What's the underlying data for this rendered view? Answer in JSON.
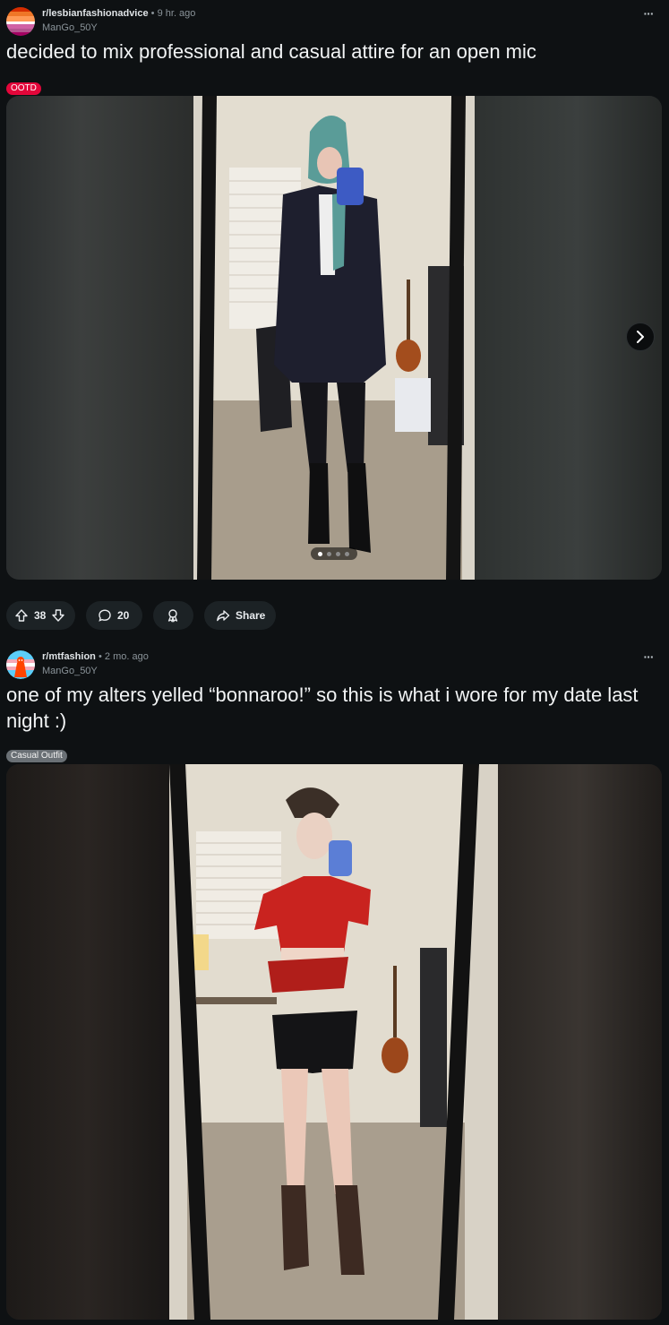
{
  "posts": [
    {
      "subreddit": "r/lesbianfashionadvice",
      "separator": "•",
      "time": "9 hr. ago",
      "author": "ManGo_50Y",
      "more_icon": "ellipsis-icon",
      "title": "decided to mix professional and casual attire for an open mic",
      "flair": "OOTD",
      "flair_color": "#e3063a",
      "media": {
        "description_icon": "photo-mirror-selfie",
        "carousel_count": 4,
        "carousel_active": 1,
        "next_icon": "chevron-right-icon"
      },
      "actions": {
        "votes": "38",
        "upvote_icon": "arrow-up-icon",
        "downvote_icon": "arrow-down-icon",
        "comments": "20",
        "comment_icon": "speech-bubble-icon",
        "award_icon": "award-icon",
        "share_label": "Share",
        "share_icon": "share-arrow-icon"
      }
    },
    {
      "subreddit": "r/mtfashion",
      "separator": "•",
      "time": "2 mo. ago",
      "author": "ManGo_50Y",
      "more_icon": "ellipsis-icon",
      "title": "one of my alters yelled “bonnaroo!” so this is what i wore for my date last night :)",
      "flair": "Casual Outfit",
      "flair_color": "#6a7075"
    }
  ],
  "colors": {
    "background": "#0e1113",
    "pill": "#1c2225",
    "text": "#f2f4f5",
    "muted": "#8a9399"
  }
}
